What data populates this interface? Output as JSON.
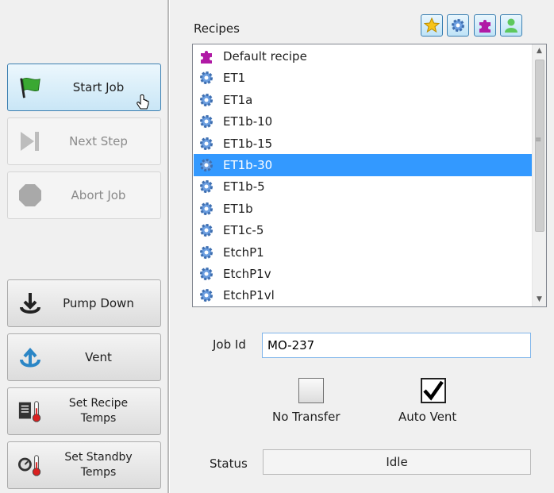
{
  "buttons": {
    "start_job": "Start Job",
    "next_step": "Next Step",
    "abort_job": "Abort Job",
    "pump_down": "Pump Down",
    "vent": "Vent",
    "set_recipe_temps_1": "Set Recipe",
    "set_recipe_temps_2": "Temps",
    "set_standby_temps_1": "Set Standby",
    "set_standby_temps_2": "Temps"
  },
  "recipes": {
    "title": "Recipes",
    "toolbar": [
      "star-icon",
      "gear-icon",
      "puzzle-icon",
      "user-icon"
    ],
    "items": [
      {
        "label": "Default recipe",
        "icon": "puzzle-icon"
      },
      {
        "label": "ET1",
        "icon": "gear-icon"
      },
      {
        "label": "ET1a",
        "icon": "gear-icon"
      },
      {
        "label": "ET1b-10",
        "icon": "gear-icon"
      },
      {
        "label": "ET1b-15",
        "icon": "gear-icon"
      },
      {
        "label": "ET1b-30",
        "icon": "gear-icon",
        "selected": true
      },
      {
        "label": "ET1b-5",
        "icon": "gear-icon"
      },
      {
        "label": "ET1b",
        "icon": "gear-icon"
      },
      {
        "label": "ET1c-5",
        "icon": "gear-icon"
      },
      {
        "label": "EtchP1",
        "icon": "gear-icon"
      },
      {
        "label": "EtchP1v",
        "icon": "gear-icon"
      },
      {
        "label": "EtchP1vl",
        "icon": "gear-icon"
      }
    ]
  },
  "job": {
    "label": "Job Id",
    "value": "MO-237"
  },
  "options": {
    "no_transfer": {
      "label": "No Transfer",
      "checked": false
    },
    "auto_vent": {
      "label": "Auto Vent",
      "checked": true
    }
  },
  "status": {
    "label": "Status",
    "value": "Idle"
  },
  "colors": {
    "selection": "#3399ff",
    "gear": "#5b8fd6",
    "puzzle": "#b01aa5",
    "accent_border": "#3c7fb1"
  }
}
